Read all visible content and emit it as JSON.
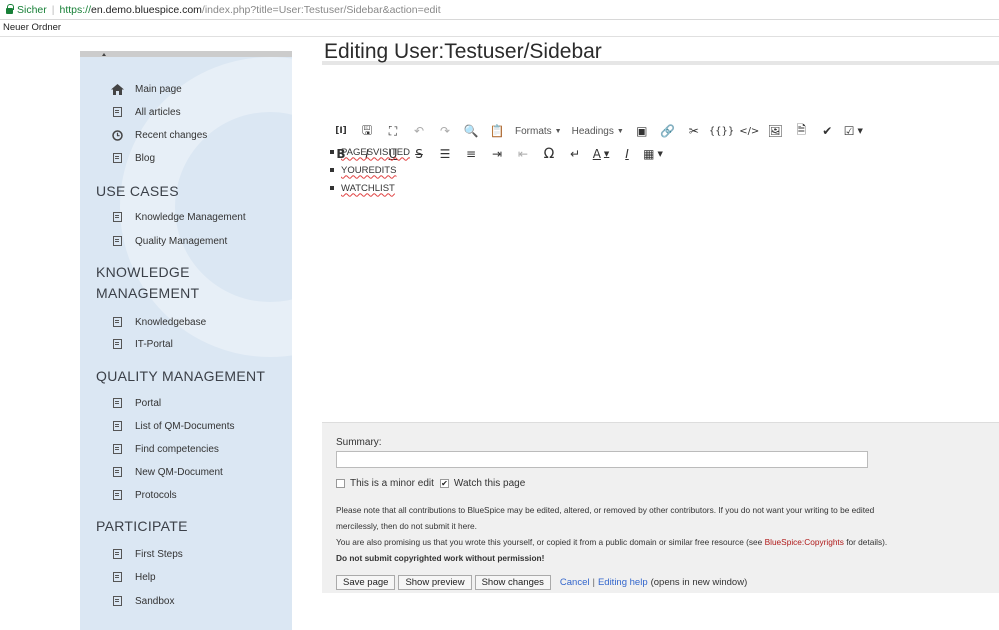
{
  "browser": {
    "secure_label": "Sicher",
    "separator": "|",
    "url_proto": "https://",
    "url_host": "en.demo.bluespice.com",
    "url_rest": "/index.php?title=User:Testuser/Sidebar&action=edit",
    "bookmark": "Neuer Ordner"
  },
  "sidebar": {
    "main_items": [
      {
        "label": "Main page",
        "icon": "home-icon"
      },
      {
        "label": "All articles",
        "icon": "doc-icon"
      },
      {
        "label": "Recent changes",
        "icon": "clock-icon"
      },
      {
        "label": "Blog",
        "icon": "doc-icon"
      }
    ],
    "sections": [
      {
        "title": "USE CASES",
        "items": [
          "Knowledge Management",
          "Quality Management"
        ]
      },
      {
        "title_line1": "KNOWLEDGE",
        "title_line2": "MANAGEMENT",
        "items": [
          "Knowledgebase",
          "IT-Portal"
        ]
      },
      {
        "title": "QUALITY MANAGEMENT",
        "items": [
          "Portal",
          "List of QM-Documents",
          "Find competencies",
          "New QM-Document",
          "Protocols"
        ]
      },
      {
        "title": "PARTICIPATE",
        "items": [
          "First Steps",
          "Help",
          "Sandbox"
        ]
      }
    ]
  },
  "main": {
    "title": "Editing User:Testuser/Sidebar",
    "toolbar_row1": {
      "formats": "Formats",
      "headings": "Headings"
    },
    "editor_items": [
      "PAGESVISITED",
      "YOUREDITS",
      "WATCHLIST"
    ],
    "summary_label": "Summary:",
    "summary_value": "",
    "minor_edit_label": "This is a minor edit",
    "minor_edit_checked": false,
    "watch_label": "Watch this page",
    "watch_checked": true,
    "notice_line1": "Please note that all contributions to BlueSpice may be edited, altered, or removed by other contributors. If you do not want your writing to be edited",
    "notice_line2": "mercilessly, then do not submit it here.",
    "notice_line3_pre": "You are also promising us that you wrote this yourself, or copied it from a public domain or similar free resource (see ",
    "notice_line3_link": "BlueSpice:Copyrights",
    "notice_line3_post": " for details).",
    "notice_line4": "Do not submit copyrighted work without permission!",
    "save_button": "Save page",
    "preview_button": "Show preview",
    "changes_button": "Show changes",
    "cancel_link": "Cancel",
    "editing_help_link": "Editing help",
    "help_note": "(opens in new window)"
  },
  "colors": {
    "sidebar_bg": "#dbe7f3",
    "secure_green": "#188038",
    "link_blue": "#3366cc",
    "copyright_red": "#b01a1a"
  }
}
